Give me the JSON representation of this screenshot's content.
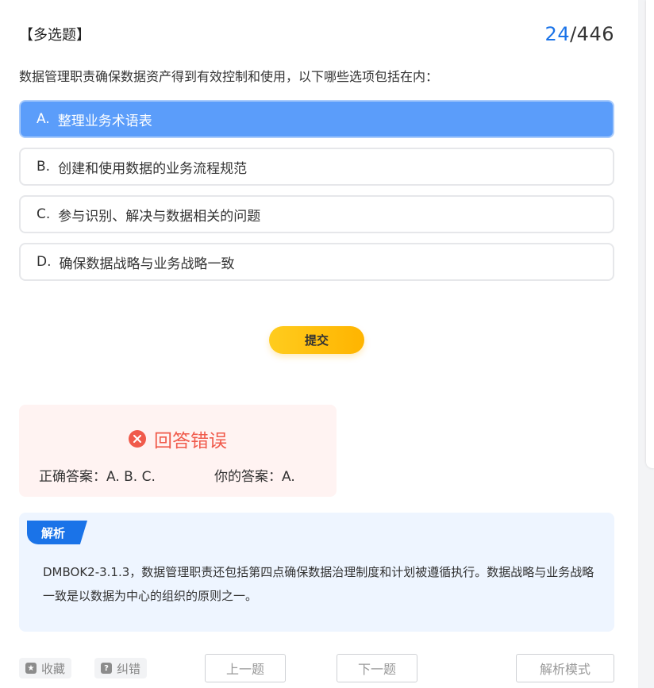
{
  "question": {
    "type_label": "【多选题】",
    "current": "24",
    "total": "/446",
    "text": "数据管理职责确保数据资产得到有效控制和使用，以下哪些选项包括在内："
  },
  "options": [
    {
      "letter": "A.",
      "text": "整理业务术语表",
      "selected": true
    },
    {
      "letter": "B.",
      "text": "创建和使用数据的业务流程规范",
      "selected": false
    },
    {
      "letter": "C.",
      "text": "参与识别、解决与数据相关的问题",
      "selected": false
    },
    {
      "letter": "D.",
      "text": "确保数据战略与业务战略一致",
      "selected": false
    }
  ],
  "submit_label": "提交",
  "result": {
    "status": "回答错误",
    "correct_answer": "正确答案：A. B. C.",
    "your_answer": "你的答案：A.",
    "status_color": "#f05a4b"
  },
  "analysis": {
    "tag": "解析",
    "text": "DMBOK2-3.1.3，数据管理职责还包括第四点确保数据治理制度和计划被遵循执行。数据战略与业务战略一致是以数据为中心的组织的原则之一。"
  },
  "footer": {
    "favorite_label": "收藏",
    "report_label": "纠错",
    "prev_label": "上一题",
    "next_label": "下一题",
    "mode_label": "解析模式"
  },
  "colors": {
    "accent": "#1a73e8",
    "selected_option": "#5b9dfa",
    "submit": "#ffb400"
  },
  "icons": {
    "status": "close-circle-icon",
    "favorite": "star-icon",
    "report": "question-icon"
  }
}
